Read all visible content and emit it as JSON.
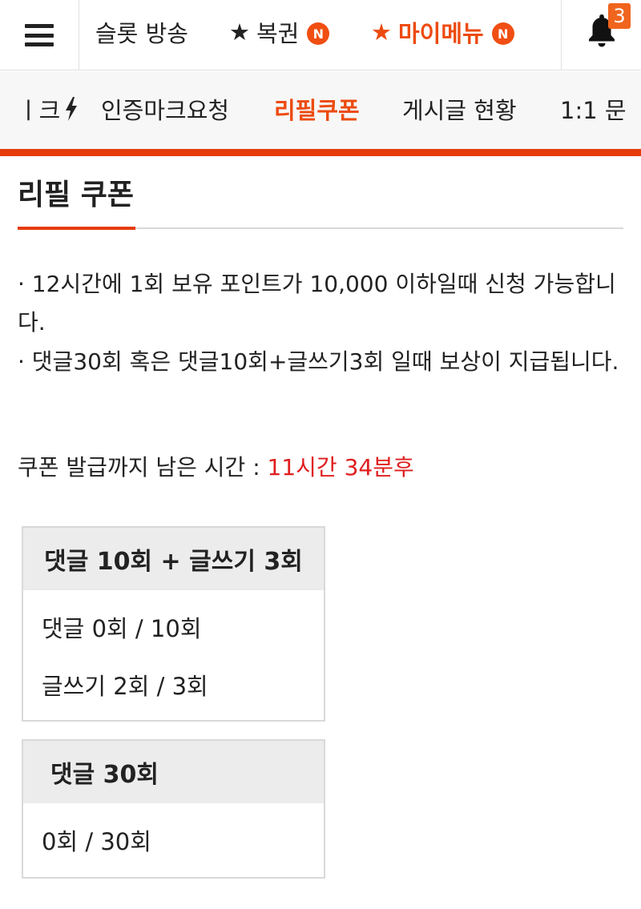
{
  "topbar": {
    "nav": [
      {
        "label": "슬롯 방송"
      },
      {
        "star": "★",
        "label": "복권",
        "badge": "N"
      },
      {
        "star": "★",
        "label": "마이메뉴",
        "badge": "N"
      }
    ],
    "notification_count": "3",
    "accent_color": "#ec4b10"
  },
  "subnav": {
    "items": [
      {
        "label": "ㅣ크",
        "icon": "lightning-icon"
      },
      {
        "label": "인증마크요청"
      },
      {
        "label": "리필쿠폰",
        "active": true
      },
      {
        "label": "게시글 현황"
      },
      {
        "label": "1:1 문"
      }
    ]
  },
  "page": {
    "title": "리필 쿠폰",
    "notices": [
      "· 12시간에 1회 보유 포인트가 10,000 이하일때 신청 가능합니다.",
      "· 댓글30회 혹은 댓글10회+글쓰기3회 일때 보상이 지급됩니다."
    ],
    "timer_label": "쿠폰 발급까지 남은 시간 : ",
    "timer_value": "11시간 34분후"
  },
  "boxes": [
    {
      "title": "댓글 10회 + 글쓰기 3회",
      "lines": [
        "댓글 0회 / 10회",
        "글쓰기 2회 / 3회"
      ]
    },
    {
      "title": "댓글 30회",
      "lines": [
        "0회 / 30회"
      ]
    }
  ]
}
